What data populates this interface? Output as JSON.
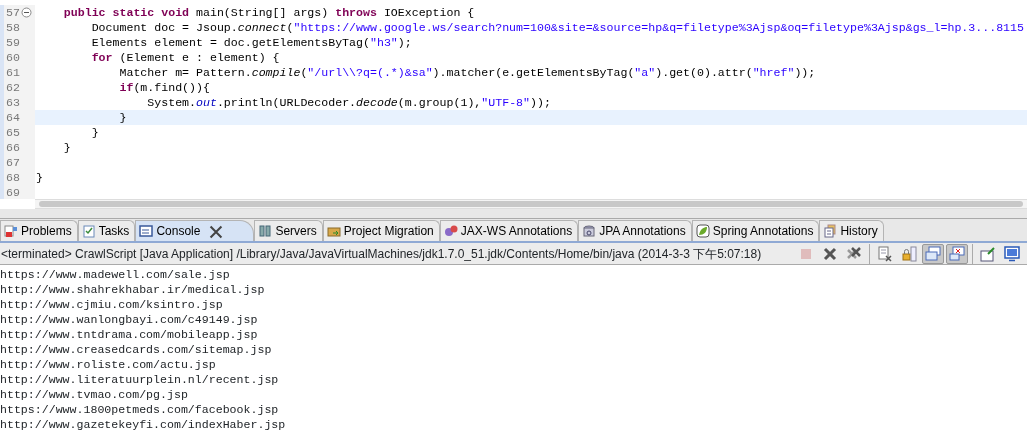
{
  "editor": {
    "lines": [
      {
        "number": "57",
        "folding": true,
        "current": false,
        "segments": [
          {
            "kind": "keyword",
            "text": "    public static void"
          },
          {
            "kind": "plain",
            "text": " main(String[] args) "
          },
          {
            "kind": "keyword",
            "text": "throws"
          },
          {
            "kind": "plain",
            "text": " IOException {"
          }
        ]
      },
      {
        "number": "58",
        "folding": false,
        "current": false,
        "segments": [
          {
            "kind": "plain",
            "text": "        Document doc = Jsoup."
          },
          {
            "kind": "static-method",
            "text": "connect"
          },
          {
            "kind": "plain",
            "text": "("
          },
          {
            "kind": "string",
            "text": "\"https://www.google.ws/search?num=100&site=&source=hp&q=filetype%3Ajsp&oq=filetype%3Ajsp&gs_l=hp.3...8115"
          }
        ]
      },
      {
        "number": "59",
        "folding": false,
        "current": false,
        "segments": [
          {
            "kind": "plain",
            "text": "        Elements element = doc.getElementsByTag("
          },
          {
            "kind": "string",
            "text": "\"h3\""
          },
          {
            "kind": "plain",
            "text": ");"
          }
        ]
      },
      {
        "number": "60",
        "folding": false,
        "current": false,
        "segments": [
          {
            "kind": "keyword",
            "text": "        for"
          },
          {
            "kind": "plain",
            "text": " (Element e : element) {"
          }
        ]
      },
      {
        "number": "61",
        "folding": false,
        "current": false,
        "segments": [
          {
            "kind": "plain",
            "text": "            Matcher m= Pattern."
          },
          {
            "kind": "static-method",
            "text": "compile"
          },
          {
            "kind": "plain",
            "text": "("
          },
          {
            "kind": "string",
            "text": "\"/url\\\\?q=(.*)&sa\""
          },
          {
            "kind": "plain",
            "text": ").matcher(e.getElementsByTag("
          },
          {
            "kind": "string",
            "text": "\"a\""
          },
          {
            "kind": "plain",
            "text": ").get(0).attr("
          },
          {
            "kind": "string",
            "text": "\"href\""
          },
          {
            "kind": "plain",
            "text": "));"
          }
        ]
      },
      {
        "number": "62",
        "folding": false,
        "current": false,
        "segments": [
          {
            "kind": "keyword",
            "text": "            if"
          },
          {
            "kind": "plain",
            "text": "(m.find()){"
          }
        ]
      },
      {
        "number": "63",
        "folding": false,
        "current": false,
        "segments": [
          {
            "kind": "plain",
            "text": "                System."
          },
          {
            "kind": "static-field",
            "text": "out"
          },
          {
            "kind": "plain",
            "text": ".println(URLDecoder."
          },
          {
            "kind": "static-method",
            "text": "decode"
          },
          {
            "kind": "plain",
            "text": "(m.group(1),"
          },
          {
            "kind": "string",
            "text": "\"UTF-8\""
          },
          {
            "kind": "plain",
            "text": "));"
          }
        ]
      },
      {
        "number": "64",
        "folding": false,
        "current": true,
        "segments": [
          {
            "kind": "plain",
            "text": "            }"
          }
        ]
      },
      {
        "number": "65",
        "folding": false,
        "current": false,
        "segments": [
          {
            "kind": "plain",
            "text": "        }"
          }
        ]
      },
      {
        "number": "66",
        "folding": false,
        "current": false,
        "segments": [
          {
            "kind": "plain",
            "text": "    }"
          }
        ]
      },
      {
        "number": "67",
        "folding": false,
        "current": false
      },
      {
        "number": "68",
        "folding": false,
        "current": false,
        "segments": [
          {
            "kind": "plain",
            "text": "}"
          }
        ]
      },
      {
        "number": "69",
        "folding": false,
        "current": false
      }
    ]
  },
  "tabs": [
    {
      "label": "Problems",
      "kind": "problems",
      "selected": false
    },
    {
      "label": "Tasks",
      "kind": "tasks",
      "selected": false
    },
    {
      "label": "Console",
      "kind": "console",
      "selected": true
    },
    {
      "label": "Servers",
      "kind": "servers",
      "selected": false
    },
    {
      "label": "Project Migration",
      "kind": "migration",
      "selected": false
    },
    {
      "label": "JAX-WS Annotations",
      "kind": "jaxws",
      "selected": false
    },
    {
      "label": "JPA Annotations",
      "kind": "jpa",
      "selected": false
    },
    {
      "label": "Spring Annotations",
      "kind": "spring",
      "selected": false
    },
    {
      "label": "History",
      "kind": "history",
      "selected": false
    }
  ],
  "console": {
    "status": "<terminated> CrawlScript [Java Application] /Library/Java/JavaVirtualMachines/jdk1.7.0_51.jdk/Contents/Home/bin/java (2014-3-3 下午5:07:18)",
    "toolbar_groups": [
      [
        {
          "kind": "stop",
          "disabled": true
        },
        {
          "kind": "remove",
          "disabled": false
        },
        {
          "kind": "remove-all",
          "disabled": false
        }
      ],
      [
        {
          "kind": "clear",
          "disabled": false,
          "selected": false
        },
        {
          "kind": "scroll-lock",
          "disabled": false,
          "selected": false
        },
        {
          "kind": "show-out",
          "disabled": false,
          "selected": true
        },
        {
          "kind": "show-err",
          "disabled": false,
          "selected": true
        }
      ],
      [
        {
          "kind": "pin",
          "disabled": false
        },
        {
          "kind": "display",
          "disabled": false
        }
      ]
    ],
    "output": [
      "https://www.madewell.com/sale.jsp",
      "http://www.shahrekhabar.ir/medical.jsp",
      "http://www.cjmiu.com/ksintro.jsp",
      "http://www.wanlongbayi.com/c49149.jsp",
      "http://www.tntdrama.com/mobileapp.jsp",
      "http://www.creasedcards.com/sitemap.jsp",
      "http://www.roliste.com/actu.jsp",
      "http://www.literatuurplein.nl/recent.jsp",
      "http://www.tvmao.com/pg.jsp",
      "https://www.1800petmeds.com/facebook.jsp",
      "http://www.gazetekeyfi.com/indexHaber.jsp"
    ]
  }
}
